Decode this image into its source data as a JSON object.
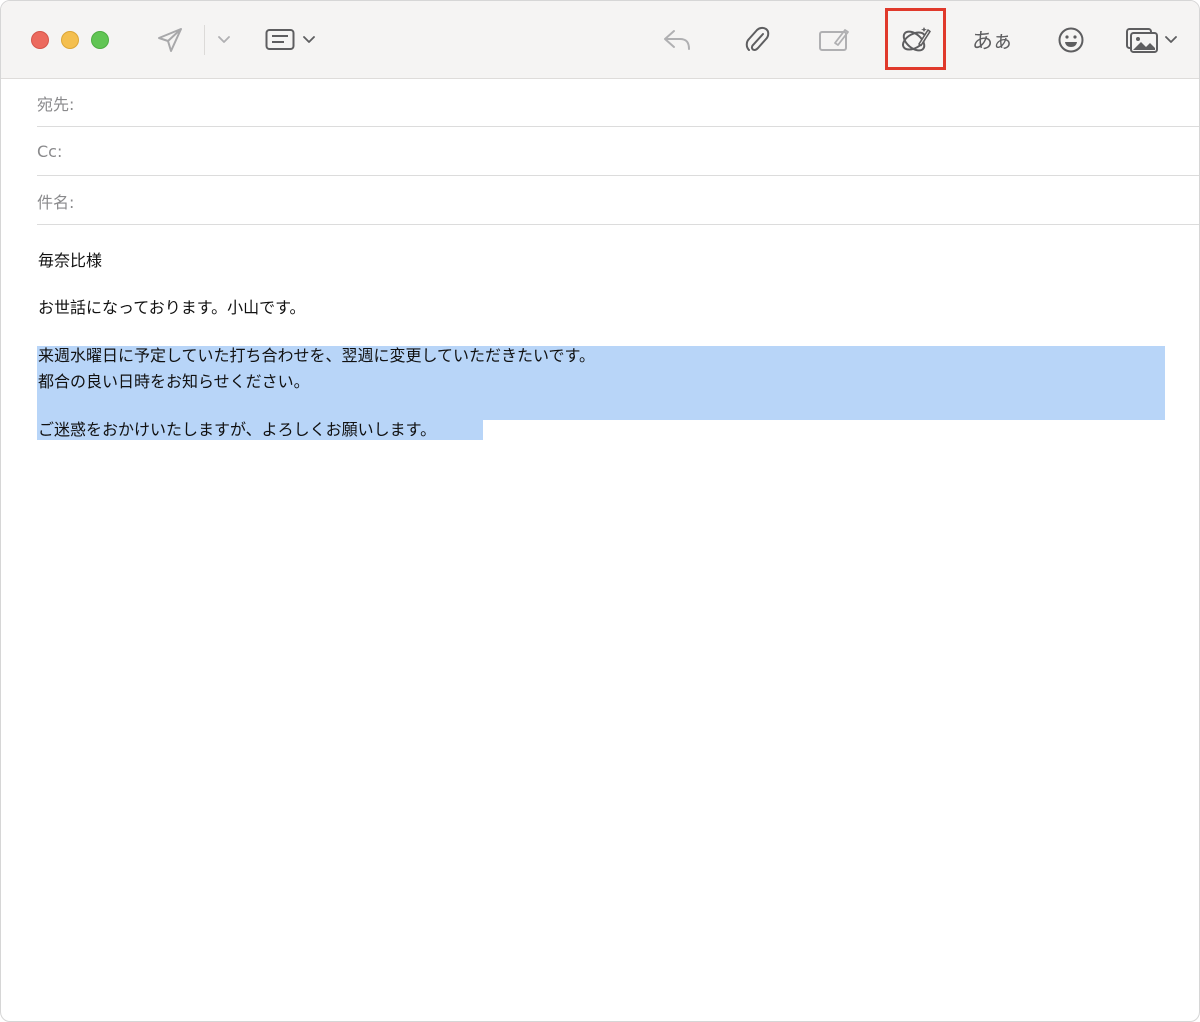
{
  "toolbar": {
    "send_icon": "paper-plane-icon",
    "send_dropdown_icon": "chevron-down-icon",
    "header_fields_icon": "header-fields-icon",
    "reply_icon": "reply-arrow-icon",
    "attach_icon": "paperclip-icon",
    "markup_icon": "markup-pen-icon",
    "writing_tools_icon": "writing-tools-icon",
    "format_label": "あぁ",
    "emoji_icon": "smiley-icon",
    "photo_icon": "photo-browser-icon",
    "highlight_color": "#e0392b"
  },
  "header": {
    "to_label": "宛先:",
    "cc_label": "Cc:",
    "subject_label": "件名:"
  },
  "message": {
    "greeting": "毎奈比様",
    "intro": "お世話になっております。小山です。",
    "para1_line1": "来週水曜日に予定していた打ち合わせを、翌週に変更していただきたいです。",
    "para1_line2": "都合の良い日時をお知らせください。",
    "closing": "ご迷惑をおかけいたしますが、よろしくお願いします。",
    "selection_color": "#b8d5f8"
  }
}
